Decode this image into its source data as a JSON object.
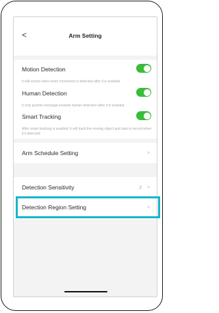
{
  "header": {
    "back_icon": "chevron-left-icon",
    "back_glyph": "<",
    "title": "Arm Setting"
  },
  "detection": {
    "motion_label": "Motion Detection",
    "motion_note": "It will record video when movement is detected after it is enabled.",
    "human_label": "Human Detection",
    "human_note": "It only pushes message towards human detection after it is enabled.",
    "smart_label": "Smart Tracking",
    "smart_note": "After smart tracking is enabled, it will track the moving object and start to record when it's detected",
    "toggle_color": "#3bbd3b"
  },
  "schedule": {
    "label": "Arm Schedule Setting",
    "chevron": ">"
  },
  "sensitivity": {
    "label": "Detection Sensitivity",
    "value": "2",
    "chevron": ">"
  },
  "region": {
    "label": "Detection Region Setting",
    "chevron": ">",
    "highlight_color": "#19b5cc"
  }
}
